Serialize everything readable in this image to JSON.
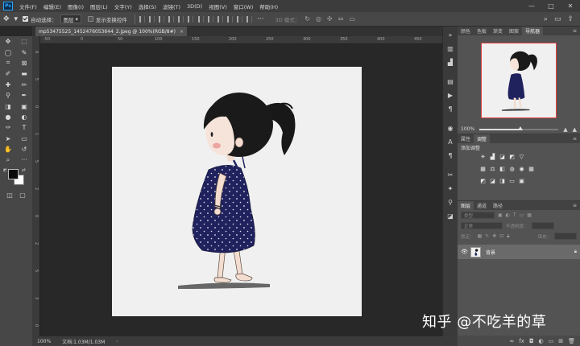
{
  "app": {
    "logo": "Ps"
  },
  "menubar": {
    "items": [
      "文件(F)",
      "编辑(E)",
      "图像(I)",
      "图层(L)",
      "文字(Y)",
      "选择(S)",
      "滤镜(T)",
      "3D(D)",
      "视图(V)",
      "窗口(W)",
      "帮助(H)"
    ],
    "window_controls": [
      "—",
      "□",
      "✕"
    ]
  },
  "options_bar": {
    "auto_select_label": "自动选择：",
    "auto_select_value": "图层",
    "show_transform_label": "显示变换控件",
    "mode_3d_label": "3D 模式："
  },
  "document": {
    "tab_title": "mp53475525_1452476053644_2.jpeg @ 100%(RGB/8#)",
    "tab_close": "×"
  },
  "rulers": {
    "top": [
      "-50",
      "0",
      "50",
      "100",
      "150",
      "200",
      "250",
      "300",
      "350",
      "400",
      "450"
    ],
    "left": [
      "0",
      "5",
      "0",
      "1",
      "5",
      "2",
      "0",
      "2",
      "5",
      "3",
      "0"
    ]
  },
  "statusbar": {
    "zoom": "100%",
    "doc_info": "文档:1.03M/1.03M",
    "arrow": "›"
  },
  "panels": {
    "top_tabs": [
      "颜色",
      "色板",
      "渐变",
      "图案",
      "导航器"
    ],
    "top_active": 4,
    "navigator_zoom": "100%",
    "navigator_zoom_fraction": 0.52,
    "mid_tabs": [
      "属性",
      "调整"
    ],
    "mid_active": 1,
    "adjustments_title": "添加调整",
    "layers_tabs": [
      "图层",
      "通道",
      "路径"
    ],
    "layers_active": 0,
    "layer_kind": "类型",
    "blend_mode": "正常",
    "opacity_label": "不透明度：",
    "lock_label": "锁定：",
    "fill_label": "填充：",
    "layer_name": "背景"
  },
  "watermark": "知乎 @不吃羊的草"
}
